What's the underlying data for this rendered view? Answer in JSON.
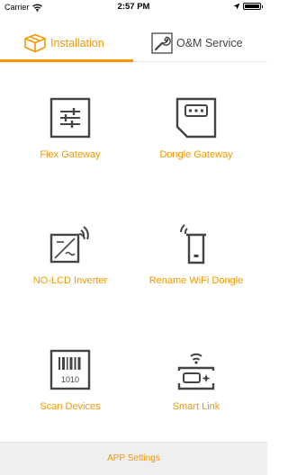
{
  "status_bar": {
    "carrier": "Carrier",
    "time": "2:57 PM",
    "battery_level": 1.0
  },
  "tabs": [
    {
      "label": "Installation",
      "icon": "box-icon",
      "active": true
    },
    {
      "label": "O&M Service",
      "icon": "wrench-icon",
      "active": false
    }
  ],
  "grid": {
    "items": [
      {
        "label": "Flex Gateway",
        "icon": "sliders-icon"
      },
      {
        "label": "Dongle Gateway",
        "icon": "sim-card-icon"
      },
      {
        "label": "NO-LCD Inverter",
        "icon": "inverter-wifi-icon"
      },
      {
        "label": "Rename WiFi Dongle",
        "icon": "wifi-dongle-icon"
      },
      {
        "label": "Scan Devices",
        "icon": "barcode-icon"
      },
      {
        "label": "Smart Link",
        "icon": "smart-link-icon"
      }
    ]
  },
  "footer": {
    "label": "APP Settings"
  },
  "colors": {
    "accent": "#f39800",
    "icon": "#444444",
    "footer_bg": "#efefef"
  }
}
